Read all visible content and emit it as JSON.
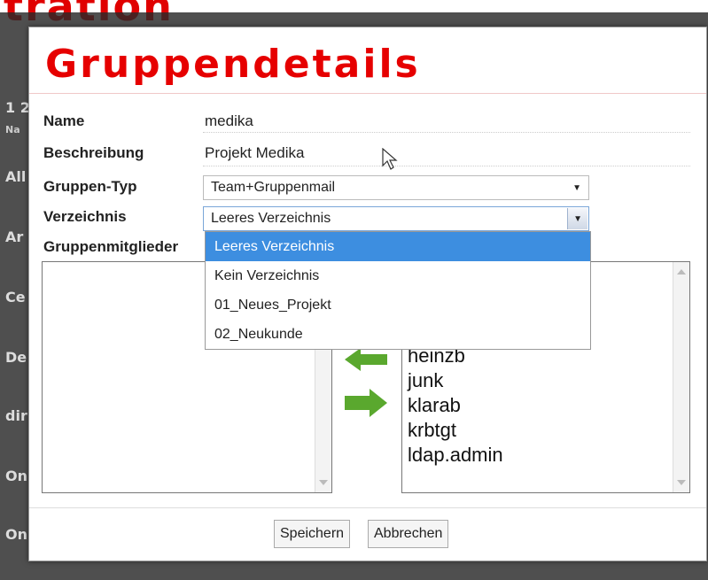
{
  "background": {
    "title_fragment": "tration",
    "left_fragments": [
      "1 2",
      "Na",
      "All",
      "Ar",
      "Ce",
      "De",
      "dir",
      "On",
      "On"
    ]
  },
  "dialog": {
    "title": "Gruppendetails",
    "fields": {
      "name_label": "Name",
      "name_value": "medika",
      "description_label": "Beschreibung",
      "description_value": "Projekt Medika",
      "group_type_label": "Gruppen-Typ",
      "group_type_value": "Team+Gruppenmail",
      "directory_label": "Verzeichnis",
      "directory_value": "Leeres Verzeichnis",
      "members_label": "Gruppenmitglieder"
    },
    "directory_options": [
      "Leeres Verzeichnis",
      "Kein Verzeichnis",
      "01_Neues_Projekt",
      "02_Neukunde"
    ],
    "directory_selected_index": 0,
    "available_users": [
      "heinzb",
      "junk",
      "klarab",
      "krbtgt",
      "ldap.admin"
    ],
    "buttons": {
      "save": "Speichern",
      "cancel": "Abbrechen"
    }
  },
  "colors": {
    "title_red": "#e60000",
    "selection_blue": "#3d8ee0",
    "arrow_green": "#5aa82e"
  }
}
